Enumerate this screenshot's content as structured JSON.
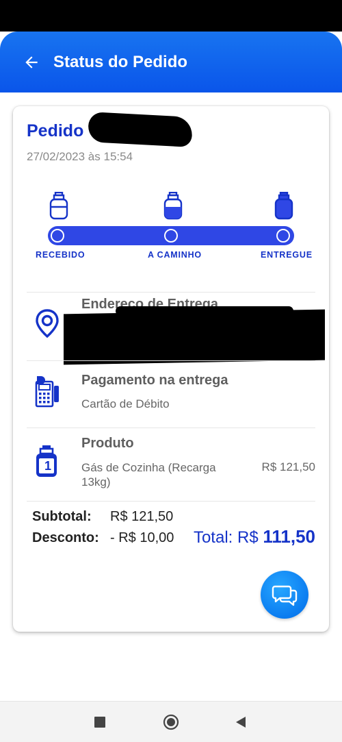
{
  "header": {
    "title": "Status do Pedido"
  },
  "order": {
    "title_prefix": "Pedido",
    "date": "27/02/2023 às 15:54"
  },
  "steps": [
    {
      "label": "RECEBIDO"
    },
    {
      "label": "A CAMINHO"
    },
    {
      "label": "ENTREGUE"
    }
  ],
  "address": {
    "title": "Endereço de Entrega"
  },
  "payment": {
    "title": "Pagamento na entrega",
    "method": "Cartão de Débito"
  },
  "product": {
    "title": "Produto",
    "name_line1": "Gás de Cozinha (Recarga",
    "name_line2": "13kg)",
    "price": "R$ 121,50",
    "quantity_badge": "1"
  },
  "totals": {
    "subtotal_label": "Subtotal:",
    "subtotal_value": "R$ 121,50",
    "discount_label": "Desconto:",
    "discount_value": "- R$ 10,00",
    "total_label": "Total: R$",
    "total_value": "111,50"
  },
  "colors": {
    "primary": "#1533c8",
    "appbar": "#0a55ea",
    "progress": "#2f47e5",
    "chat": "#0b7cf0"
  },
  "icons": [
    "back-arrow-icon",
    "gas-cylinder-icon",
    "location-pin-icon",
    "card-terminal-icon",
    "chat-bubbles-icon",
    "square-nav-icon",
    "home-circle-nav-icon",
    "back-triangle-nav-icon"
  ]
}
